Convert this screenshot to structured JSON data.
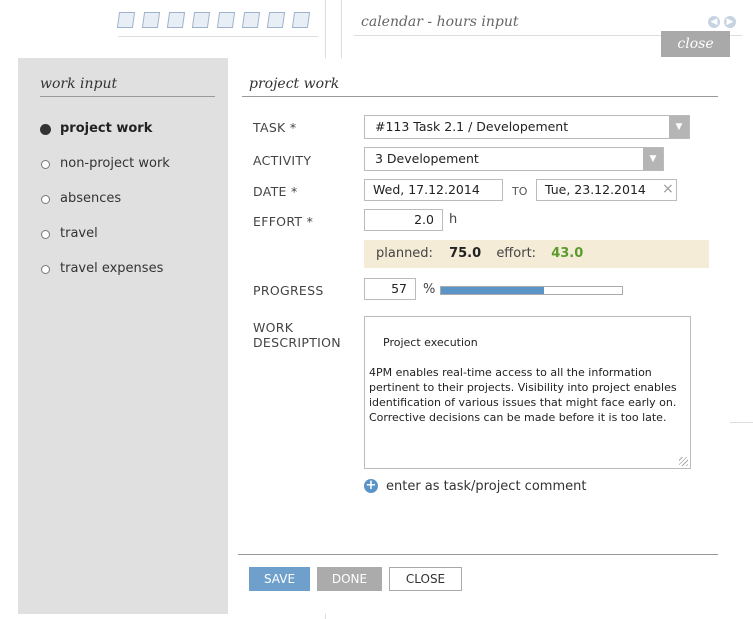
{
  "calendar": {
    "title": "calendar - hours input"
  },
  "close_top": {
    "label": "close"
  },
  "sidebar": {
    "title": "work input",
    "items": [
      {
        "label": "project work",
        "active": true
      },
      {
        "label": "non-project work",
        "active": false
      },
      {
        "label": "absences",
        "active": false
      },
      {
        "label": "travel",
        "active": false
      },
      {
        "label": "travel expenses",
        "active": false
      }
    ]
  },
  "main": {
    "title": "project work",
    "task": {
      "label": "TASK *",
      "value": "#113 Task 2.1 / Developement"
    },
    "activity": {
      "label": "ACTIVITY",
      "value": "3 Developement"
    },
    "date": {
      "label": "DATE *",
      "from": "Wed, 17.12.2014",
      "to_label": "TO",
      "to": "Tue, 23.12.2014",
      "clear_symbol": "×"
    },
    "effort": {
      "label": "EFFORT *",
      "value": "2.0",
      "unit": "h"
    },
    "planned": {
      "planned_label": "planned:",
      "planned_value": "75.0",
      "effort_label": "effort:",
      "effort_value": "43.0"
    },
    "progress": {
      "label": "PROGRESS",
      "value": "57",
      "unit": "%",
      "bar_fraction": 0.57
    },
    "description": {
      "label_line1": "WORK",
      "label_line2": "DESCRIPTION",
      "text": "Project execution\n\n4PM enables real-time access to all the information pertinent to their projects. Visibility into project enables identification of various issues that might face early on. Corrective decisions can be made before it is too late."
    },
    "comment": {
      "label": "enter as task/project comment",
      "icon": "+"
    }
  },
  "buttons": {
    "save": "SAVE",
    "done": "DONE",
    "close": "CLOSE"
  },
  "colors": {
    "accent": "#5b94c6",
    "planned_bg": "#f4ecd6",
    "effort_green": "#5b9a2e",
    "sidebar_bg": "#e0e0e0"
  }
}
